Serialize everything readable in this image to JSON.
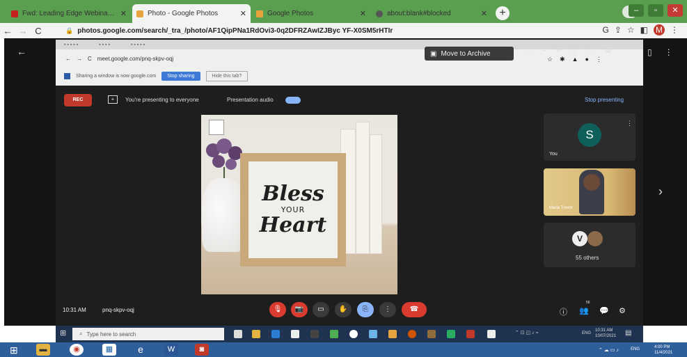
{
  "browser": {
    "tabs": [
      {
        "title": "Fwd: Leading Edge Webinar - Sc",
        "favicon_color": "#c5221f"
      },
      {
        "title": "Photo - Google Photos",
        "favicon_color": "#e8a33d"
      },
      {
        "title": "Google Photos",
        "favicon_color": "#e8a33d"
      },
      {
        "title": "about:blank#blocked",
        "favicon_color": "#555555"
      }
    ],
    "new_tab_glyph": "+",
    "url": "photos.google.com/search/_tra_/photo/AF1QipPNa1RdOvi3-0q2DFRZAwIZJByc YF-X0SM5rHTIr",
    "nav": {
      "back": "←",
      "forward": "→",
      "reload": "C"
    }
  },
  "viewer": {
    "back_glyph": "←",
    "next_glyph": "›",
    "accent": "#141414"
  },
  "inner_screen": {
    "url": "meet.google.com/pnq-skpv-oqj",
    "share_notice": "Sharing a window is now google.com",
    "stop_sharing": "Stop sharing",
    "hide_message": "Hide this tab?",
    "archive_button": "Move to Archive"
  },
  "meet": {
    "rec_label": "REC",
    "presenting_text": "You're presenting to everyone",
    "presentation_audio": "Presentation audio",
    "stop_presenting": "Stop presenting",
    "sign": {
      "line1": "Bless",
      "line2": "YOUR",
      "line3": "Heart"
    },
    "participants": {
      "you": {
        "initial": "S",
        "label": "You"
      },
      "maria": {
        "label": "Maria Trevor"
      },
      "others": {
        "initial": "V",
        "label": "55 others"
      }
    },
    "time": "10:31 AM",
    "meeting_code": "pnq-skpv-oqj",
    "people_count": "56"
  },
  "inner_taskbar": {
    "search_placeholder": "Type here to search",
    "lang": "ENG",
    "time": "10:31 AM",
    "date": "10/07/2021"
  },
  "outer_taskbar": {
    "lang": "ENG",
    "time": "4:00 PM",
    "date": "11/4/2021"
  }
}
